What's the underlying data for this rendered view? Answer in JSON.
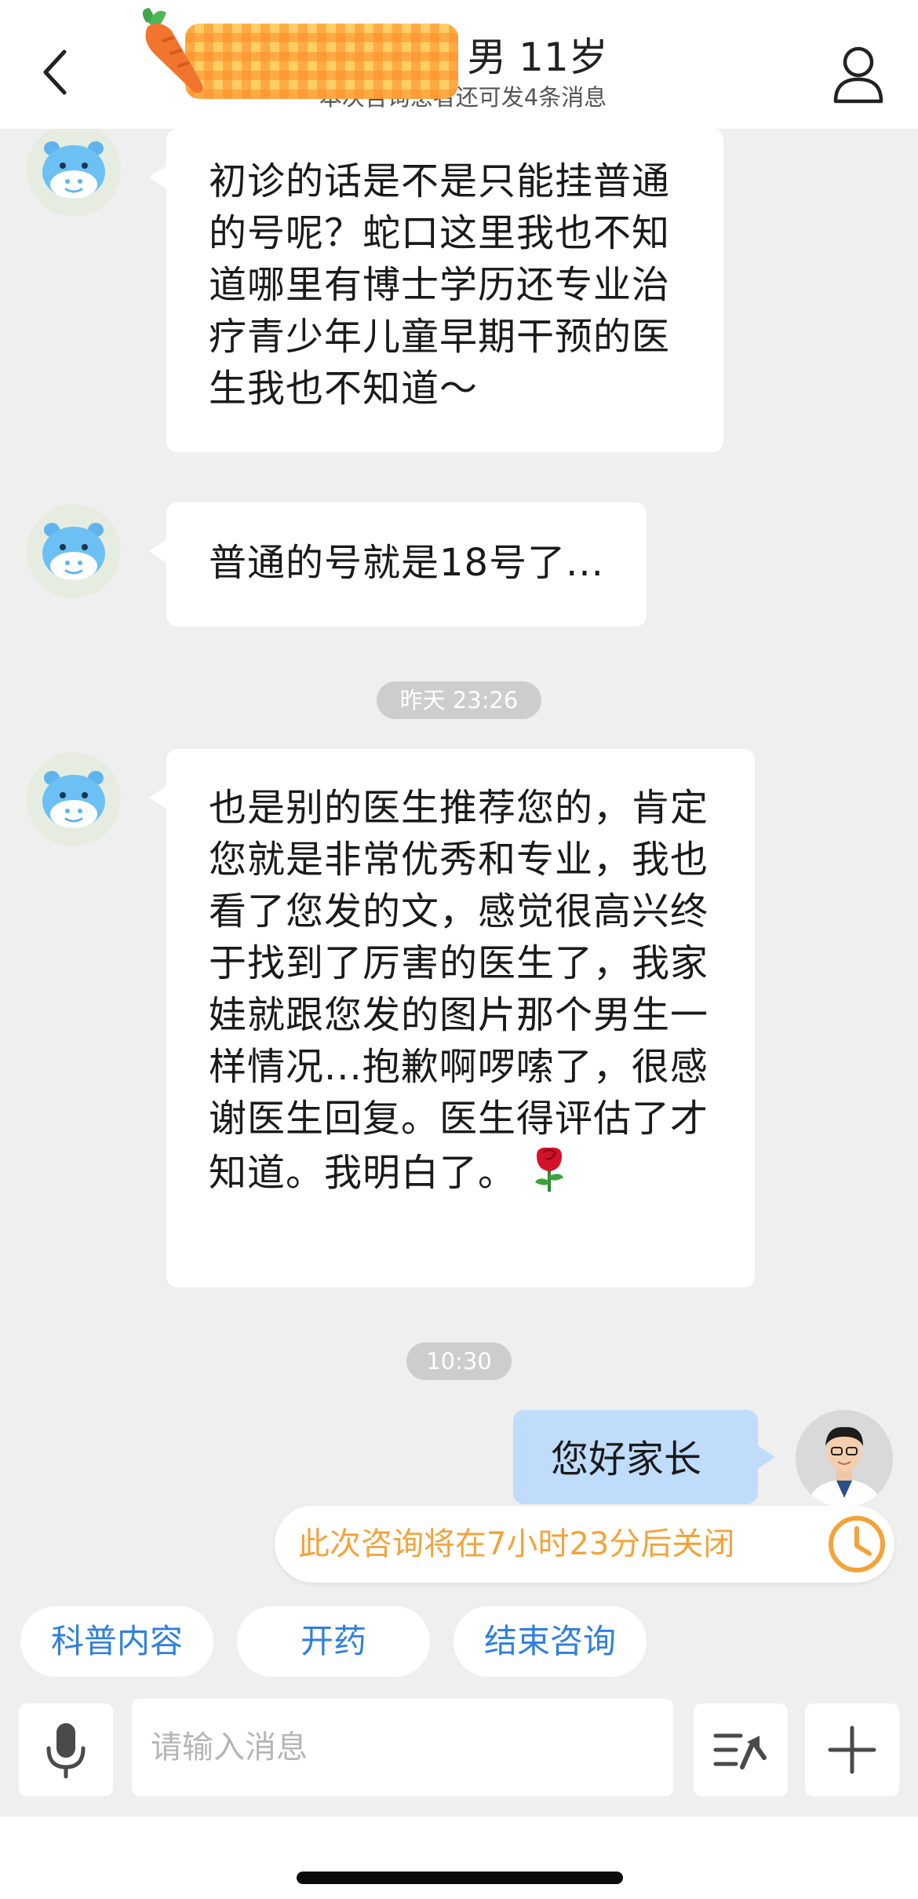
{
  "header": {
    "title_suffix": "男 11岁",
    "subtitle": "本次咨询患者还可发4条消息"
  },
  "messages": [
    {
      "from": "patient",
      "text": "初诊的话是不是只能挂普通的号呢？蛇口这里我也不知道哪里有博士学历还专业治疗青少年儿童早期干预的医生我也不知道～"
    },
    {
      "from": "patient",
      "text": "普通的号就是18号了..."
    },
    {
      "time": "昨天 23:26"
    },
    {
      "from": "patient",
      "text": "也是别的医生推荐您的，肯定您就是非常优秀和专业，我也看了您发的文，感觉很高兴终于找到了厉害的医生了，我家娃就跟您发的图片那个男生一样情况...抱歉啊啰嗦了，很感谢医生回复。医生得评估了才知道。我明白了。",
      "emoji": "rose"
    },
    {
      "time": "10:30"
    },
    {
      "from": "doctor",
      "text": "您好家长"
    }
  ],
  "notice": {
    "text": "此次咨询将在7小时23分后关闭",
    "icon": "clock-icon",
    "color": "#f3a33a"
  },
  "quick_actions": [
    "科普内容",
    "开药",
    "结束咨询"
  ],
  "input": {
    "placeholder": "请输入消息",
    "value": ""
  },
  "icons": {
    "back": "chevron-left-icon",
    "profile": "person-icon",
    "mic": "microphone-icon",
    "menu": "quick-reply-icon",
    "plus": "plus-icon"
  },
  "colors": {
    "accent": "#2f7fe0",
    "doctor_bubble": "#bfdcfb",
    "patient_bubble": "#ffffff",
    "background": "#efefef"
  }
}
